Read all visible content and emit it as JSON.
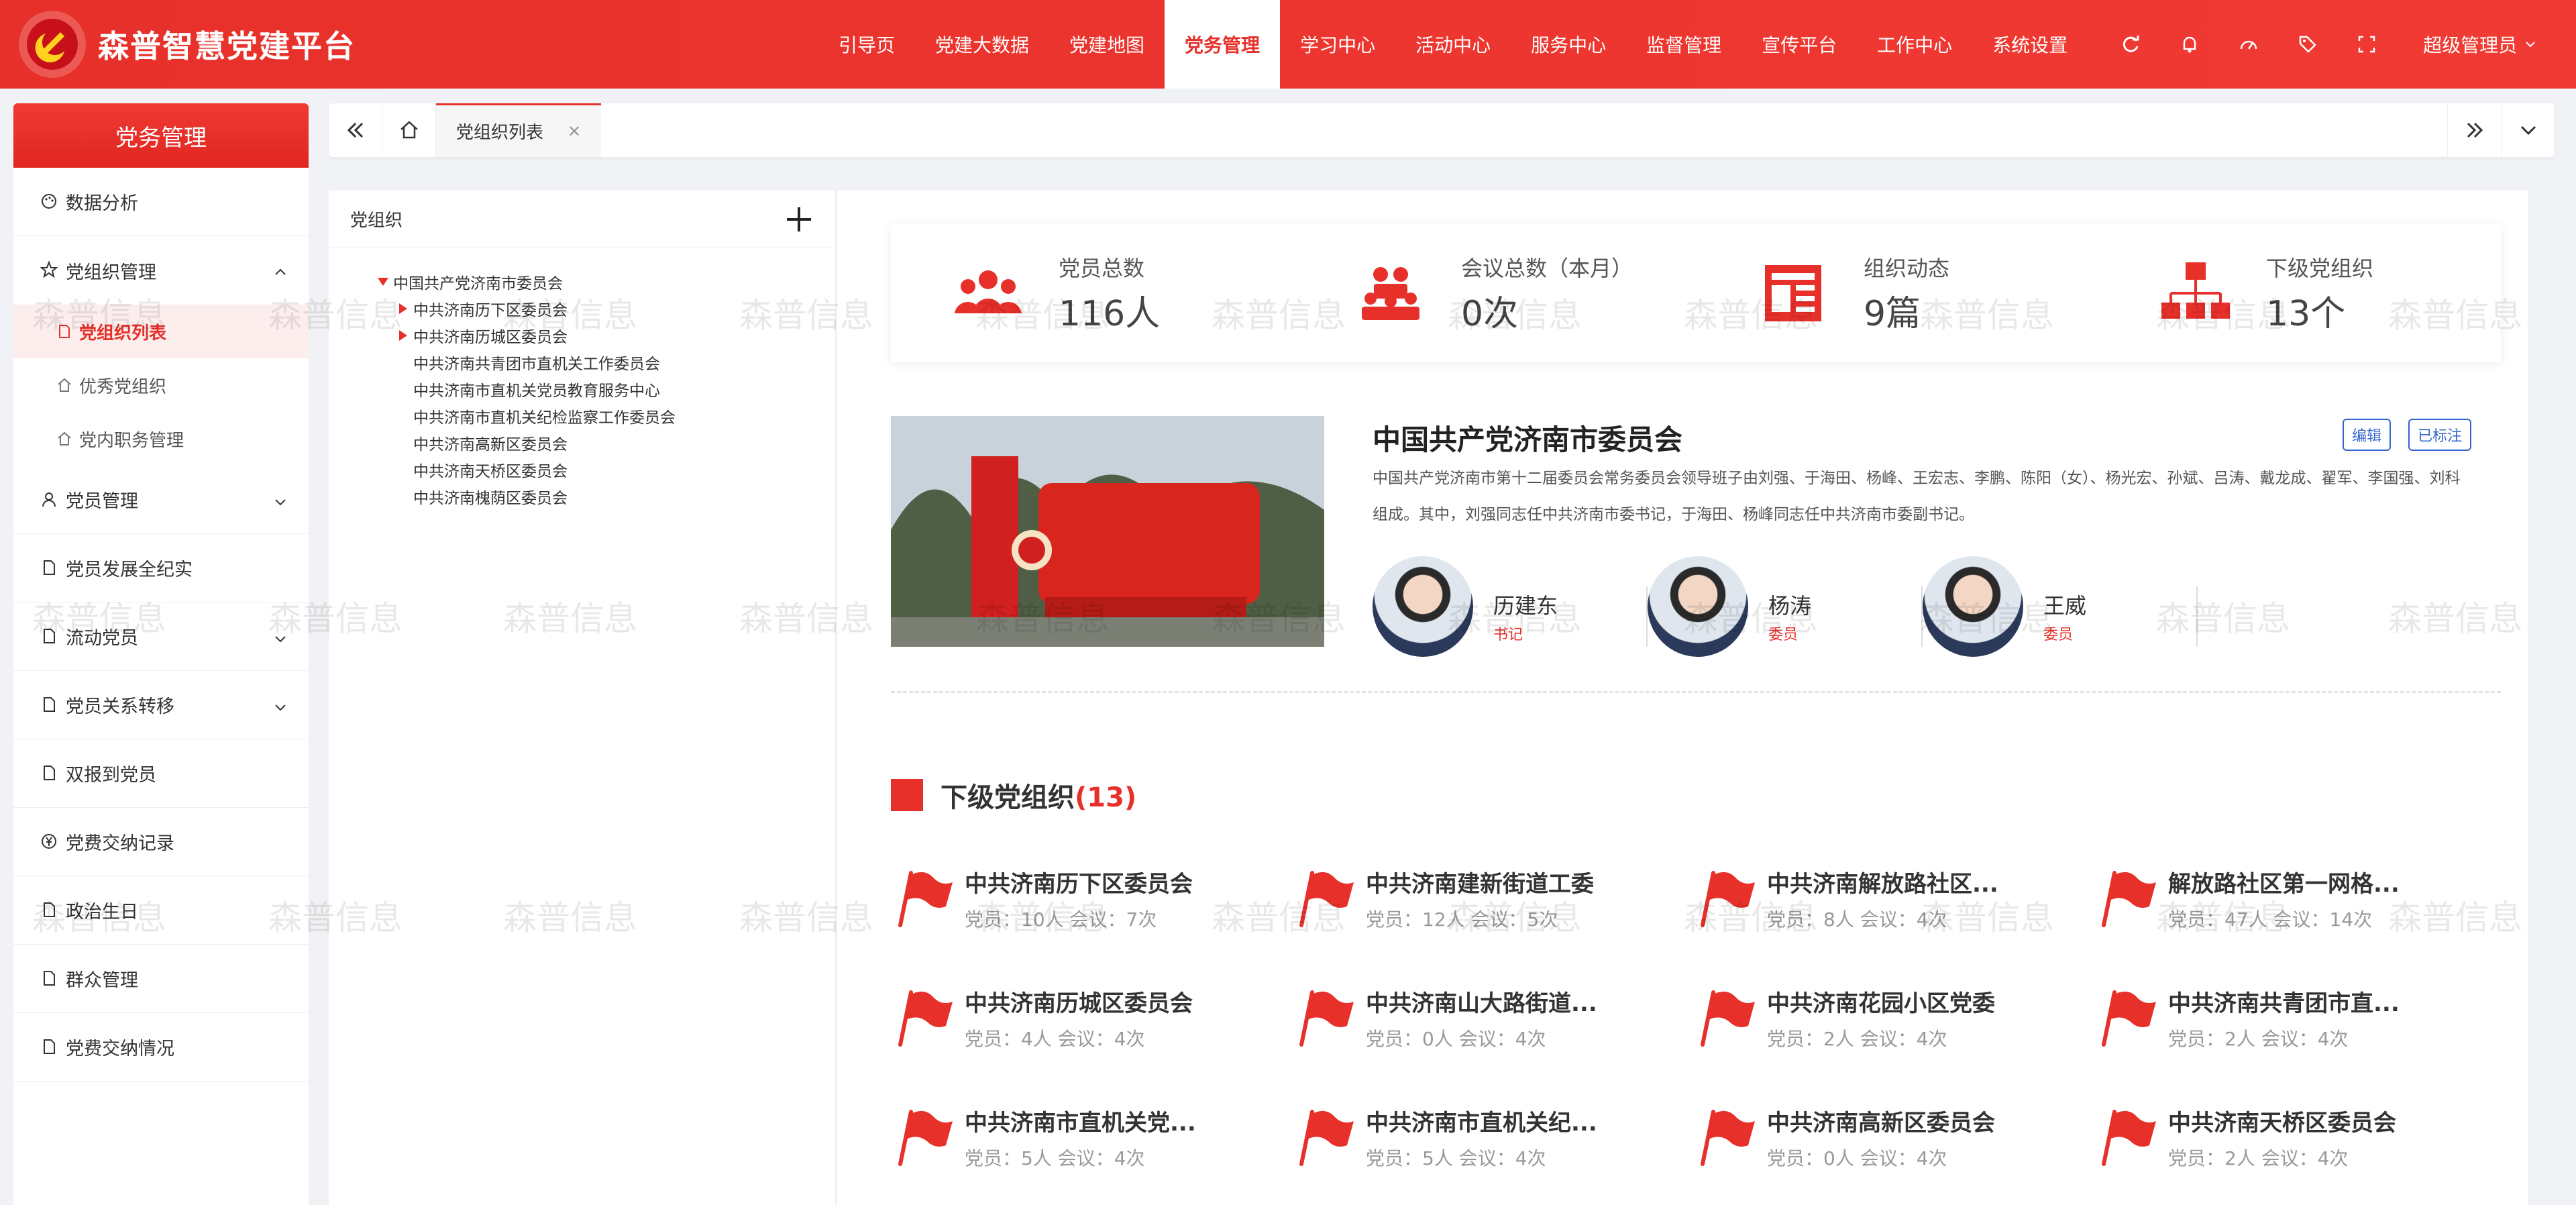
{
  "app": {
    "title": "森普智慧党建平台"
  },
  "nav": {
    "items": [
      {
        "label": "引导页"
      },
      {
        "label": "党建大数据"
      },
      {
        "label": "党建地图"
      },
      {
        "label": "党务管理",
        "active": true
      },
      {
        "label": "学习中心"
      },
      {
        "label": "活动中心"
      },
      {
        "label": "服务中心"
      },
      {
        "label": "监督管理"
      },
      {
        "label": "宣传平台"
      },
      {
        "label": "工作中心"
      },
      {
        "label": "系统设置"
      }
    ],
    "icons": [
      "refresh-icon",
      "bell-icon",
      "dashboard-icon",
      "tag-icon",
      "fullscreen-icon"
    ],
    "user": "超级管理员"
  },
  "sidebar": {
    "title": "党务管理",
    "items": [
      {
        "label": "数据分析",
        "icon": "palette-icon"
      },
      {
        "label": "党组织管理",
        "icon": "star-icon",
        "expanded": true,
        "children": [
          {
            "label": "党组织列表",
            "active": true
          },
          {
            "label": "优秀党组织"
          },
          {
            "label": "党内职务管理"
          }
        ]
      },
      {
        "label": "党员管理",
        "icon": "user-icon"
      },
      {
        "label": "党员发展全纪实",
        "icon": "doc-icon"
      },
      {
        "label": "流动党员",
        "icon": "doc-icon"
      },
      {
        "label": "党员关系转移",
        "icon": "doc-icon"
      },
      {
        "label": "双报到党员",
        "icon": "doc-icon"
      },
      {
        "label": "党费交纳记录",
        "icon": "yen-icon"
      },
      {
        "label": "政治生日",
        "icon": "doc-icon"
      },
      {
        "label": "群众管理",
        "icon": "doc-icon"
      },
      {
        "label": "党费交纳情况",
        "icon": "doc-icon"
      }
    ]
  },
  "tabs": {
    "active_label": "党组织列表"
  },
  "tree": {
    "title": "党组织",
    "root": "中国共产党济南市委员会",
    "children": [
      {
        "label": "中共济南历下区委员会",
        "has_children": true
      },
      {
        "label": "中共济南历城区委员会",
        "has_children": true
      },
      {
        "label": "中共济南共青团市直机关工作委员会",
        "has_children": false
      },
      {
        "label": "中共济南市直机关党员教育服务中心",
        "has_children": false
      },
      {
        "label": "中共济南市直机关纪检监察工作委员会",
        "has_children": false
      },
      {
        "label": "中共济南高新区委员会",
        "has_children": false
      },
      {
        "label": "中共济南天桥区委员会",
        "has_children": false
      },
      {
        "label": "中共济南槐荫区委员会",
        "has_children": false
      }
    ]
  },
  "stats": [
    {
      "label": "党员总数",
      "value": "116人",
      "icon": "people-group-icon"
    },
    {
      "label": "会议总数（本月）",
      "value": "0次",
      "icon": "meeting-icon"
    },
    {
      "label": "组织动态",
      "value": "9篇",
      "icon": "news-icon"
    },
    {
      "label": "下级党组织",
      "value": "13个",
      "icon": "org-tree-icon"
    }
  ],
  "org": {
    "name": "中国共产党济南市委员会",
    "edit_label": "编辑",
    "marked_label": "已标注",
    "description": "中国共产党济南市第十二届委员会常务委员会领导班子由刘强、于海田、杨峰、王宏志、李鹏、陈阳（女）、杨光宏、孙斌、吕涛、戴龙成、翟军、李国强、刘科组成。其中，刘强同志任中共济南市委书记，于海田、杨峰同志任中共济南市委副书记。",
    "leaders": [
      {
        "name": "历建东",
        "role": "书记"
      },
      {
        "name": "杨涛",
        "role": "委员"
      },
      {
        "name": "王威",
        "role": "委员"
      }
    ]
  },
  "sub_orgs": {
    "title": "下级党组织",
    "count": "(13)",
    "member_prefix": "党员：",
    "meeting_prefix": "会议：",
    "items": [
      {
        "name": "中共济南历下区委员会",
        "meta": "党员：10人 会议：7次"
      },
      {
        "name": "中共济南建新街道工委",
        "meta": "党员：12人 会议：5次"
      },
      {
        "name": "中共济南解放路社区...",
        "meta": "党员：8人 会议：4次"
      },
      {
        "name": "解放路社区第一网格...",
        "meta": "党员：47人 会议：14次"
      },
      {
        "name": "中共济南历城区委员会",
        "meta": "党员：4人 会议：4次"
      },
      {
        "name": "中共济南山大路街道...",
        "meta": "党员：0人 会议：4次"
      },
      {
        "name": "中共济南花园小区党委",
        "meta": "党员：2人 会议：4次"
      },
      {
        "name": "中共济南共青团市直...",
        "meta": "党员：2人 会议：4次"
      },
      {
        "name": "中共济南市直机关党...",
        "meta": "党员：5人 会议：4次"
      },
      {
        "name": "中共济南市直机关纪...",
        "meta": "党员：5人 会议：4次"
      },
      {
        "name": "中共济南高新区委员会",
        "meta": "党员：0人 会议：4次"
      },
      {
        "name": "中共济南天桥区委员会",
        "meta": "党员：2人 会议：4次"
      }
    ]
  },
  "watermark": "森普信息",
  "colors": {
    "primary": "#e8302a",
    "link": "#3366cc"
  }
}
